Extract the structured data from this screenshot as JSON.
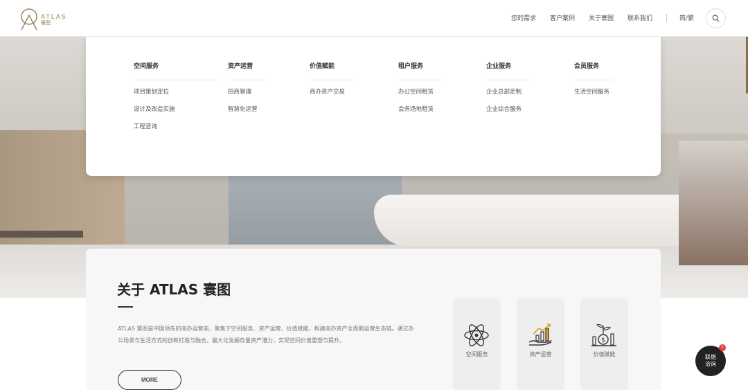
{
  "header": {
    "logo_en": "ATLAS",
    "logo_cn": "寰图",
    "nav": [
      "您的需求",
      "客户案例",
      "关于寰图",
      "联系我们"
    ],
    "lang": "简/繁",
    "search_icon": "search-icon"
  },
  "menu": {
    "columns": [
      {
        "title": "空间服务",
        "items": [
          "项目策划定位",
          "设计及改造实施",
          "工程咨询"
        ]
      },
      {
        "title": "资产运营",
        "items": [
          "招商管理",
          "智慧化运营"
        ]
      },
      {
        "title": "价值赋能",
        "items": [
          "商办资产交易"
        ]
      },
      {
        "title": "租户服务",
        "items": [
          "办公空间租赁",
          "会务场地租赁"
        ]
      },
      {
        "title": "企业服务",
        "items": [
          "企业总部定制",
          "企业综合服务"
        ]
      },
      {
        "title": "会员服务",
        "items": [
          "生活空间服务"
        ]
      }
    ]
  },
  "about": {
    "title": "关于 ATLAS 寰图",
    "text": "ATLAS 寰图是中国领先的商办运营商，聚焦于空间服务、资产运营、价值赋能，构建商办资产全周期运营生态链。通过办公场景与生活方式的创新打造与融合，最大化发掘存量资产潜力，实现空间价值重塑与提升。",
    "more": "MORE",
    "cards": [
      {
        "label": "空间服务",
        "icon": "atom-icon"
      },
      {
        "label": "资产运营",
        "icon": "growth-chart-icon"
      },
      {
        "label": "价值赋能",
        "icon": "value-plant-icon"
      }
    ]
  },
  "chat": {
    "label_line1": "联络",
    "label_line2": "洽询",
    "badge": "1"
  },
  "colors": {
    "brand": "#9a7d5a",
    "accent_bar": "#8a6c47",
    "badge": "#e53a3a"
  }
}
